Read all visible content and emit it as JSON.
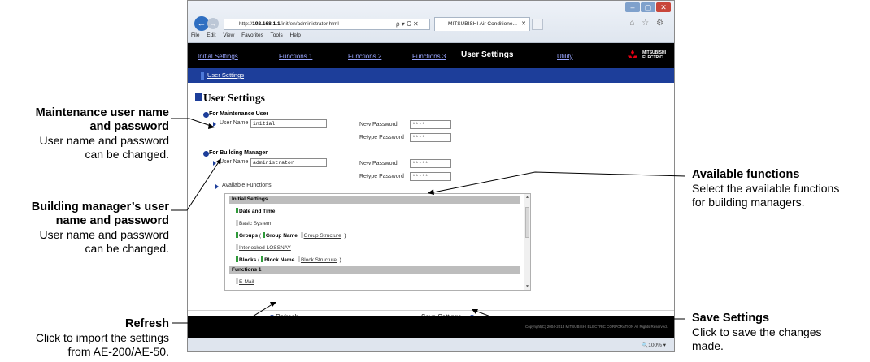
{
  "callouts": {
    "maintenance": {
      "title_line1": "Maintenance user name",
      "title_line2": "and password",
      "desc_line1": "User name and password",
      "desc_line2": "can be changed."
    },
    "building_manager": {
      "title_line1": "Building manager’s user",
      "title_line2": "name and password",
      "desc_line1": "User name and password",
      "desc_line2": "can be changed."
    },
    "refresh": {
      "title": "Refresh",
      "desc_line1": "Click to import the settings",
      "desc_line2": "from AE-200/AE-50."
    },
    "available": {
      "title": "Available functions",
      "desc_line1": "Select the available functions",
      "desc_line2": "for building managers."
    },
    "save": {
      "title": "Save Settings",
      "desc_line1": "Click to save the changes",
      "desc_line2": "made."
    }
  },
  "browser": {
    "address_prefix": "http://",
    "address_host": "192.168.1.1",
    "address_path": "/init/en/administrator.html",
    "address_icons": "ρ ▾ C ✕",
    "tab_title": "MITSUBISHI Air Conditione...",
    "tab_close": "✕",
    "window_min": "–",
    "window_max": "▢",
    "window_close": "✕",
    "back": "←",
    "forward": "→",
    "toolbar_icons": "⌂ ☆ ⚙",
    "menu": [
      "File",
      "Edit",
      "View",
      "Favorites",
      "Tools",
      "Help"
    ],
    "zoom": "🔍100%  ▾"
  },
  "app": {
    "nav": [
      "Initial Settings",
      "Functions 1",
      "Functions 2",
      "Functions 3"
    ],
    "nav_current": "User Settings",
    "nav_utility": "Utility",
    "logo_line1": "MITSUBISHI",
    "logo_line2": "ELECTRIC",
    "subnav": "User Settings",
    "page_title": "User Settings",
    "maintenance": {
      "heading": "For Maintenance User",
      "username_label": "User Name",
      "username": "initial",
      "new_pw_label": "New Password",
      "new_pw": "****",
      "retype_label": "Retype Password",
      "retype": "****"
    },
    "building_manager": {
      "heading": "For Building Manager",
      "username_label": "User Name",
      "username": "administrator",
      "new_pw_label": "New Password",
      "new_pw": "*****",
      "retype_label": "Retype Password",
      "retype": "*****"
    },
    "available_label": "Available Functions",
    "functions": {
      "initial_header": "Initial Settings",
      "date_time": "Date and Time",
      "basic_system": "Basic System",
      "groups": "Groups",
      "group_name": "Group Name",
      "group_structure": "Group Structure",
      "interlocked": "Interlocked LOSSNAY",
      "blocks": "Blocks",
      "block_name": "Block Name",
      "block_structure": "Block Structure",
      "functions1_header": "Functions 1",
      "email": "E-Mail"
    },
    "refresh": "Refresh",
    "save": "Save Settings",
    "copyright": "Copyright(C) 2004-2013 MITSUBISHI ELECTRIC CORPORATION All Rights Reserved."
  }
}
